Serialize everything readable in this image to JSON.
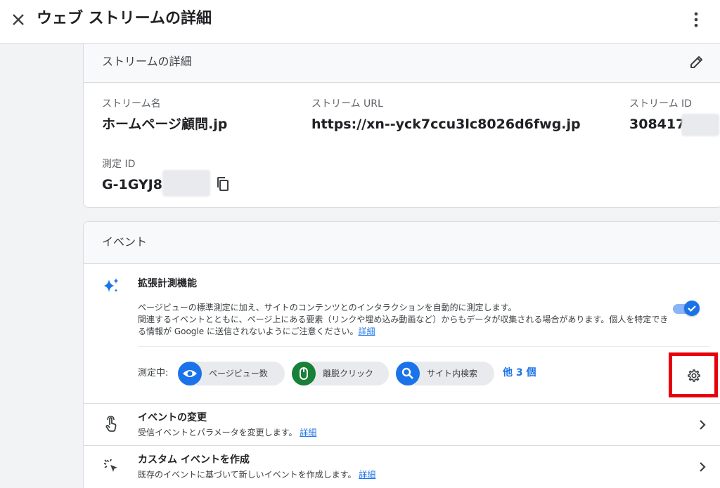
{
  "header": {
    "title": "ウェブ ストリームの詳細"
  },
  "stream_details": {
    "section_title": "ストリームの詳細",
    "name_label": "ストリーム名",
    "name_value": "ホームページ顧問.jp",
    "url_label": "ストリーム URL",
    "url_value": "https://xn--yck7ccu3lc8026d6fwg.jp",
    "id_label": "ストリーム ID",
    "id_value": "308417",
    "measurement_label": "測定 ID",
    "measurement_value": "G-1GYJ8"
  },
  "events": {
    "section_title": "イベント",
    "enhanced": {
      "title": "拡張計測機能",
      "desc_line1": "ページビューの標準測定に加え、サイトのコンテンツとのインタラクションを自動的に測定します。",
      "desc_line2": "関連するイベントとともに、ページ上にある要素（リンクや埋め込み動画など）からもデータが収集される場合があります。個人を特定できる情報が Google に送信されないようにご注意ください。",
      "desc_link": "詳細",
      "enabled": true,
      "measuring_label": "測定中:",
      "chips": [
        {
          "label": "ページビュー数",
          "icon": "eye-icon",
          "color": "#1a73e8"
        },
        {
          "label": "離脱クリック",
          "icon": "mouse-icon",
          "color": "#188038"
        },
        {
          "label": "サイト内検索",
          "icon": "search-icon",
          "color": "#1a73e8"
        }
      ],
      "more_label": "他 3 個"
    },
    "rows": [
      {
        "title": "イベントの変更",
        "subtitle": "受信イベントとパラメータを変更します。",
        "link": "詳細"
      },
      {
        "title": "カスタム イベントを作成",
        "subtitle": "既存のイベントに基づいて新しいイベントを作成します。",
        "link": "詳細"
      }
    ]
  },
  "colors": {
    "accent": "#1a73e8",
    "highlight_border": "#e8000c"
  }
}
